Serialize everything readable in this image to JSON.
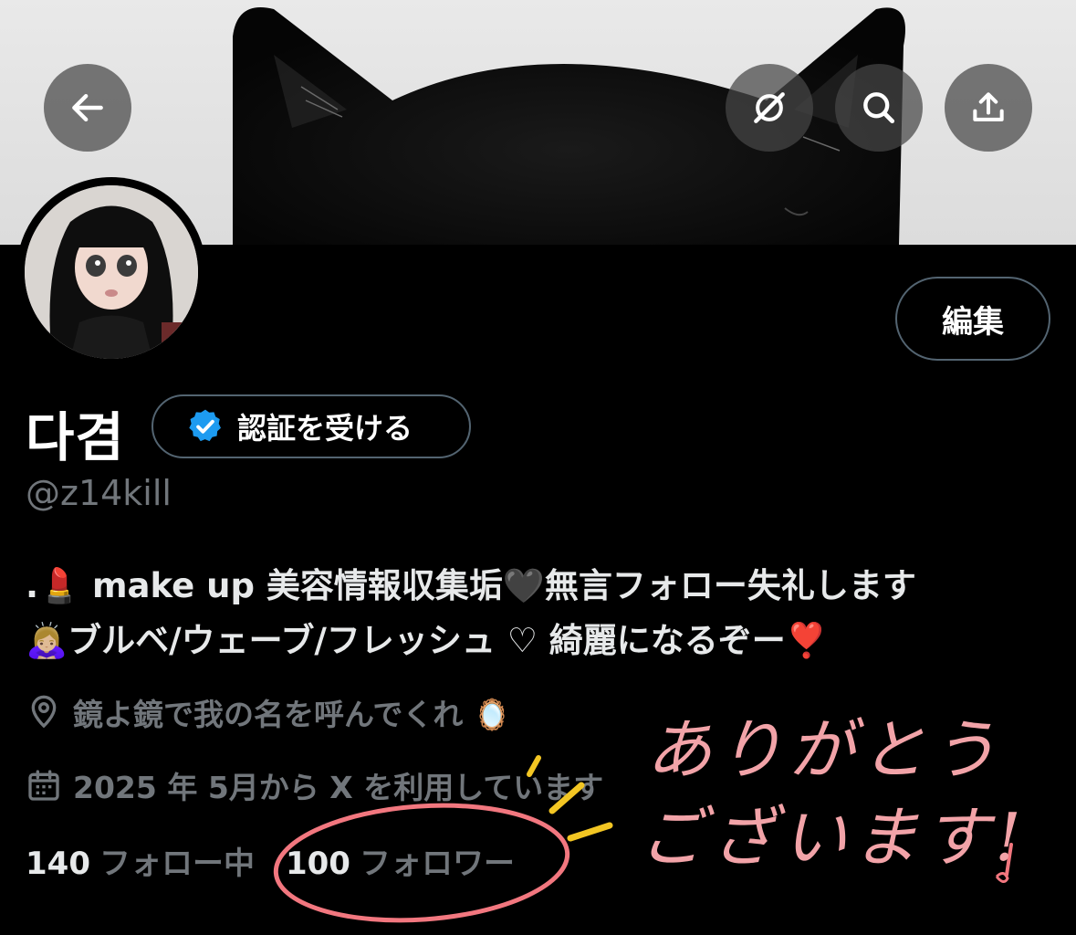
{
  "profile": {
    "name": "다겸",
    "handle": "@z14kill",
    "edit_label": "編集",
    "verify_label": "認証を受ける",
    "bio_line1": ".💄 make up 美容情報収集垢🖤無言フォロー失礼します",
    "bio_line2": "🙇🏼‍♀️ブルベ/ウェーブ/フレッシュ ♡ 綺麗になるぞー❣️",
    "location": "鏡よ鏡で我の名を呼んでくれ 🪞",
    "joined": "2025 年 5月から X を利用しています",
    "following_count": "140",
    "following_label": "フォロー中",
    "followers_count": "100",
    "followers_label": "フォロワー"
  },
  "annotation": {
    "line1": "ありがとう",
    "line2": "ございます!"
  },
  "icons": {
    "back": "back-arrow-icon",
    "grok": "grok-icon",
    "search": "search-icon",
    "share": "share-icon",
    "verified": "verified-badge-icon",
    "location": "location-pin-icon",
    "calendar": "calendar-icon"
  },
  "colors": {
    "background": "#000000",
    "muted_text": "#71767b",
    "verified_blue": "#1d9bf0",
    "annotation_pink": "#f2a3a8",
    "annotation_yellow": "#f3c623"
  }
}
